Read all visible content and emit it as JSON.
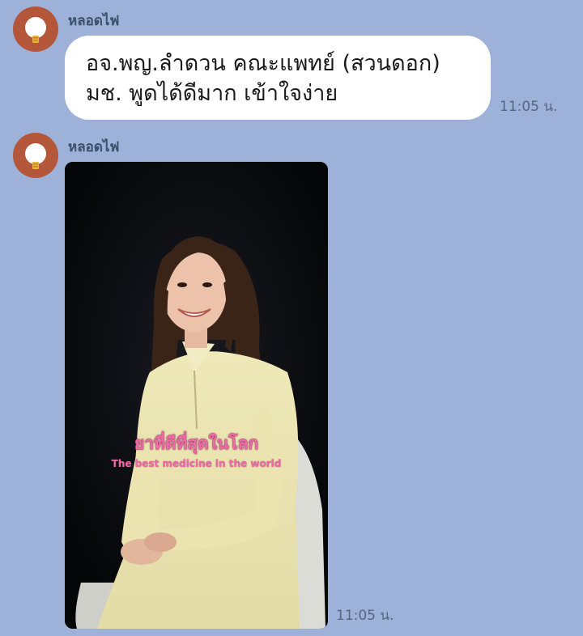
{
  "messages": [
    {
      "sender": "หลอดไฟ",
      "text_line1": "อจ.พญ.ลำดวน คณะแพทย์ (สวนดอก)",
      "text_line2": "มช. พูดได้ดีมาก เข้าใจง่าย",
      "time": "11:05 น."
    },
    {
      "sender": "หลอดไฟ",
      "video_caption_th": "ยาที่ดีที่สุดในโลก",
      "video_caption_en": "The best medicine in the world",
      "time": "11:05 น."
    }
  ],
  "colors": {
    "chat_background": "#9db1d9",
    "bubble": "#ffffff",
    "avatar": "#b4563a",
    "sender_text": "#3e4f6b",
    "caption": "#f06aa6"
  },
  "icons": {
    "avatar": "lightbulb-icon"
  }
}
